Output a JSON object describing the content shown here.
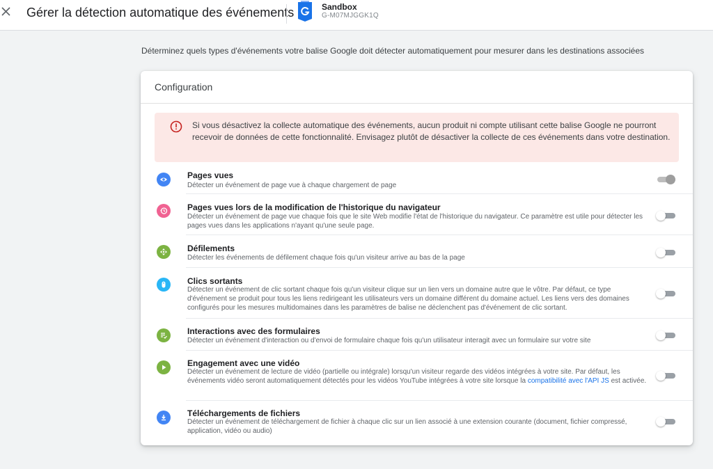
{
  "header": {
    "title": "Gérer la détection automatique des événements",
    "account_name": "Sandbox",
    "account_id": "G-M07MJGGK1Q"
  },
  "intro": "Déterminez quels types d'événements votre balise Google doit détecter automatiquement pour mesurer dans les destinations associées",
  "card": {
    "title": "Configuration",
    "alert": "Si vous désactivez la collecte automatique des événements, aucun produit ni compte utilisant cette balise Google ne pourront recevoir de données de cette fonctionnalité. Envisagez plutôt de désactiver la collecte de ces événements dans votre destination."
  },
  "events": [
    {
      "title": "Pages vues",
      "description": "Détecter un événement de page vue à chaque chargement de page",
      "icon": "eye-icon",
      "color": "#4285f4",
      "enabled": true
    },
    {
      "title": "Pages vues lors de la modification de l'historique du navigateur",
      "description": "Détecter un événement de page vue chaque fois que le site Web modifie l'état de l'historique du navigateur. Ce paramètre est utile pour détecter les pages vues dans les applications n'ayant qu'une seule page.",
      "icon": "history-icon",
      "color": "#f06292",
      "enabled": false
    },
    {
      "title": "Défilements",
      "description": "Détecter les événements de défilement chaque fois qu'un visiteur arrive au bas de la page",
      "icon": "move-icon",
      "color": "#7cb342",
      "enabled": false
    },
    {
      "title": "Clics sortants",
      "description": "Détecter un événement de clic sortant chaque fois qu'un visiteur clique sur un lien vers un domaine autre que le vôtre. Par défaut, ce type d'événement se produit pour tous les liens redirigeant les utilisateurs vers un domaine différent du domaine actuel. Les liens vers des domaines configurés pour les mesures multidomaines dans les paramètres de balise ne déclenchent pas d'événement de clic sortant.",
      "icon": "mouse-icon",
      "color": "#29b6f6",
      "enabled": false
    },
    {
      "title": "Interactions avec des formulaires",
      "description": "Détecter un événement d'interaction ou d'envoi de formulaire chaque fois qu'un utilisateur interagit avec un formulaire sur votre site",
      "icon": "form-check-icon",
      "color": "#7cb342",
      "enabled": false
    },
    {
      "title": "Engagement avec une vidéo",
      "description_before": "Détecter un événement de lecture de vidéo (partielle ou intégrale) lorsqu'un visiteur regarde des vidéos intégrées à votre site. Par défaut, les événements vidéo seront automatiquement détectés pour les vidéos YouTube intégrées à votre site lorsque la ",
      "description_link": "compatibilité avec l'API JS",
      "description_after": " est activée.",
      "icon": "play-icon",
      "color": "#7cb342",
      "enabled": false
    },
    {
      "title": "Téléchargements de fichiers",
      "description": "Détecter un événement de téléchargement de fichier à chaque clic sur un lien associé à une extension courante (document, fichier compressé, application, vidéo ou audio)",
      "icon": "download-icon",
      "color": "#4285f4",
      "enabled": false
    }
  ]
}
